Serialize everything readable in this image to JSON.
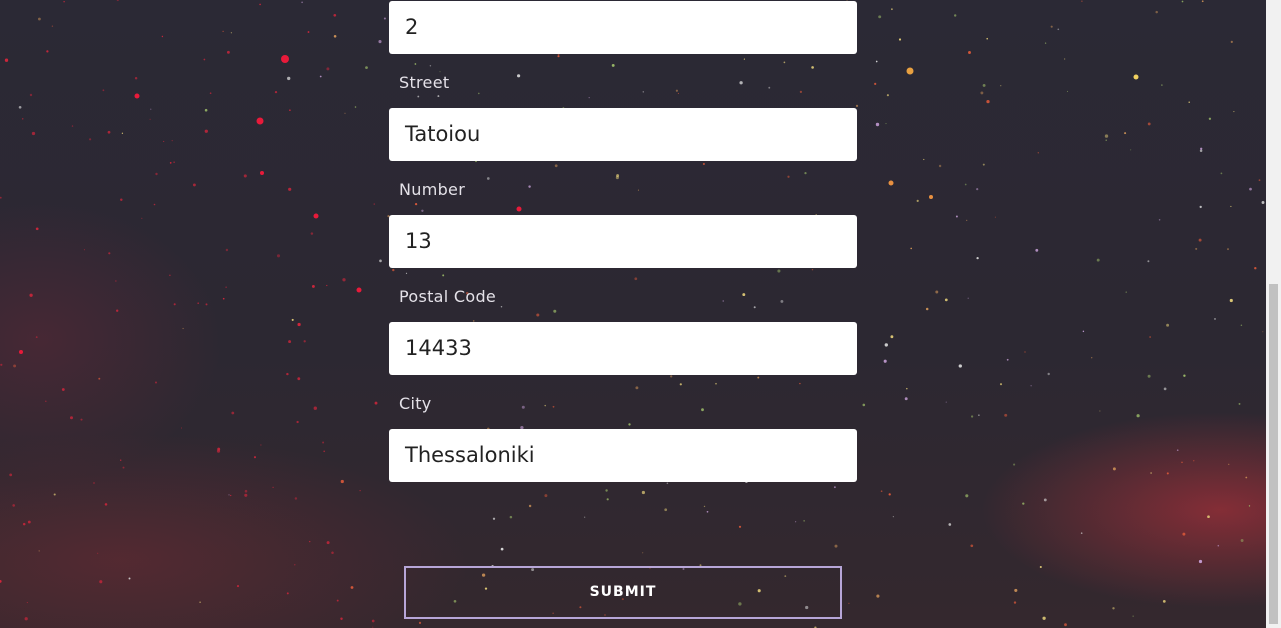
{
  "form": {
    "fields": [
      {
        "label": "",
        "value": "2"
      },
      {
        "label": "Street",
        "value": "Tatoiou"
      },
      {
        "label": "Number",
        "value": "13"
      },
      {
        "label": "Postal Code",
        "value": "14433"
      },
      {
        "label": "City",
        "value": "Thessaloniki"
      }
    ],
    "submit_label": "SUBMIT"
  },
  "colors": {
    "background": "#2b2935",
    "button_border": "#b7a6d8",
    "input_background": "#ffffff",
    "label_text": "#e4e1e8"
  }
}
